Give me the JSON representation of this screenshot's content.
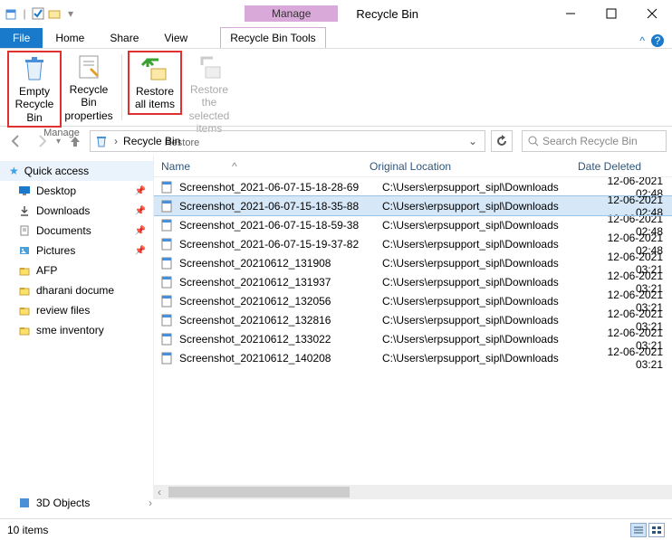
{
  "titlebar": {
    "ctx_label": "Manage",
    "window_title": "Recycle Bin"
  },
  "tabs": {
    "file": "File",
    "home": "Home",
    "share": "Share",
    "view": "View",
    "ctx": "Recycle Bin Tools"
  },
  "ribbon": {
    "empty": "Empty Recycle Bin",
    "props": "Recycle Bin properties",
    "group_manage": "Manage",
    "restore_all": "Restore all items",
    "restore_sel": "Restore the selected items",
    "group_restore": "Restore"
  },
  "nav": {
    "crumb": "Recycle Bin",
    "search_placeholder": "Search Recycle Bin"
  },
  "columns": {
    "name": "Name",
    "loc": "Original Location",
    "date": "Date Deleted"
  },
  "sidebar": {
    "quick": "Quick access",
    "items": [
      {
        "label": "Desktop",
        "icon": "desktop",
        "pin": true
      },
      {
        "label": "Downloads",
        "icon": "download",
        "pin": true
      },
      {
        "label": "Documents",
        "icon": "doc",
        "pin": true
      },
      {
        "label": "Pictures",
        "icon": "pic",
        "pin": true
      },
      {
        "label": "AFP",
        "icon": "folder",
        "pin": false
      },
      {
        "label": "dharani docume",
        "icon": "folder",
        "pin": false
      },
      {
        "label": "review files",
        "icon": "folder",
        "pin": false
      },
      {
        "label": "sme inventory",
        "icon": "folder",
        "pin": false
      }
    ],
    "bottom": "3D Objects"
  },
  "files": [
    {
      "name": "Screenshot_2021-06-07-15-18-28-69",
      "loc": "C:\\Users\\erpsupport_sipl\\Downloads",
      "date": "12-06-2021 02:48",
      "sel": false
    },
    {
      "name": "Screenshot_2021-06-07-15-18-35-88",
      "loc": "C:\\Users\\erpsupport_sipl\\Downloads",
      "date": "12-06-2021 02:48",
      "sel": true
    },
    {
      "name": "Screenshot_2021-06-07-15-18-59-38",
      "loc": "C:\\Users\\erpsupport_sipl\\Downloads",
      "date": "12-06-2021 02:48",
      "sel": false
    },
    {
      "name": "Screenshot_2021-06-07-15-19-37-82",
      "loc": "C:\\Users\\erpsupport_sipl\\Downloads",
      "date": "12-06-2021 02:48",
      "sel": false
    },
    {
      "name": "Screenshot_20210612_131908",
      "loc": "C:\\Users\\erpsupport_sipl\\Downloads",
      "date": "12-06-2021 03:21",
      "sel": false
    },
    {
      "name": "Screenshot_20210612_131937",
      "loc": "C:\\Users\\erpsupport_sipl\\Downloads",
      "date": "12-06-2021 03:21",
      "sel": false
    },
    {
      "name": "Screenshot_20210612_132056",
      "loc": "C:\\Users\\erpsupport_sipl\\Downloads",
      "date": "12-06-2021 03:21",
      "sel": false
    },
    {
      "name": "Screenshot_20210612_132816",
      "loc": "C:\\Users\\erpsupport_sipl\\Downloads",
      "date": "12-06-2021 03:21",
      "sel": false
    },
    {
      "name": "Screenshot_20210612_133022",
      "loc": "C:\\Users\\erpsupport_sipl\\Downloads",
      "date": "12-06-2021 03:21",
      "sel": false
    },
    {
      "name": "Screenshot_20210612_140208",
      "loc": "C:\\Users\\erpsupport_sipl\\Downloads",
      "date": "12-06-2021 03:21",
      "sel": false
    }
  ],
  "status": {
    "count": "10 items"
  }
}
